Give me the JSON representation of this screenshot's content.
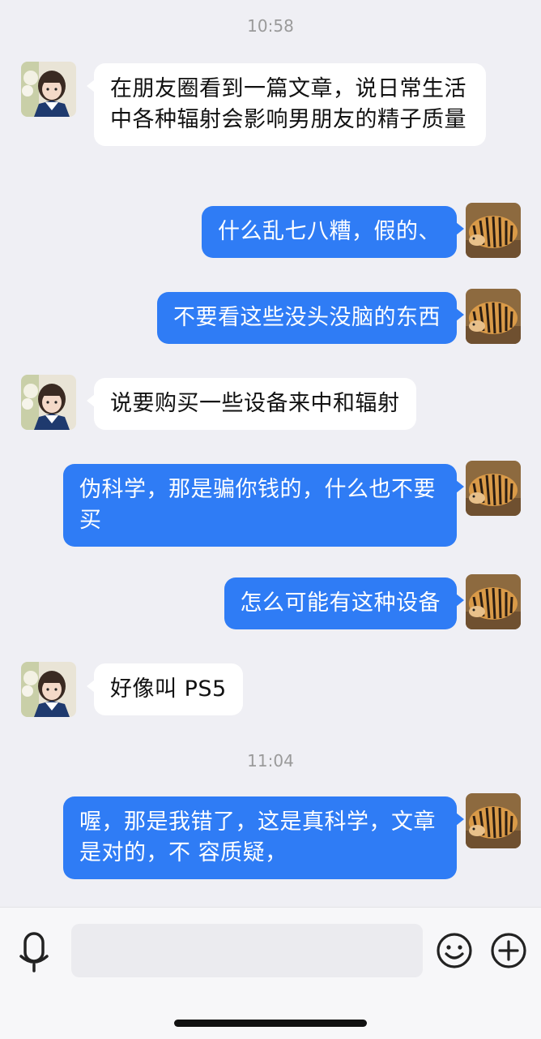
{
  "chat": {
    "time_1": "10:58",
    "time_2": "11:04",
    "messages": [
      {
        "sender": "girlfriend",
        "text": "在朋友圈看到一篇文章，说日常生活中各种辐射会影响男朋友的精子质量"
      },
      {
        "sender": "me",
        "text": "什么乱七八糟，假的、"
      },
      {
        "sender": "me",
        "text": "不要看这些没头没脑的东西"
      },
      {
        "sender": "girlfriend",
        "text": "说要购买一些设备来中和辐射"
      },
      {
        "sender": "me",
        "text": "伪科学，那是骗你钱的，什么也不要买"
      },
      {
        "sender": "me",
        "text": "怎么可能有这种设备"
      },
      {
        "sender": "girlfriend",
        "text": "好像叫 PS5"
      },
      {
        "sender": "me",
        "text": "喔，那是我错了，这是真科学，文章是对的，不 容质疑，"
      }
    ]
  },
  "input_bar": {
    "value": "",
    "mic_icon": "microphone-icon",
    "emoji_icon": "smiley-icon",
    "plus_icon": "plus-circle-icon"
  },
  "colors": {
    "background": "#efeff4",
    "outgoing_bubble": "#2f7cf5",
    "incoming_bubble": "#ffffff"
  }
}
